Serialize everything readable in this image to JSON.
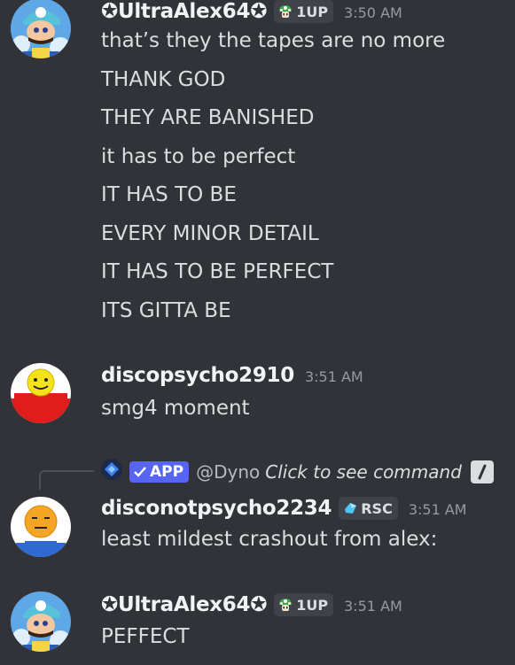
{
  "messages": [
    {
      "username": "✪UltraAlex64✪",
      "tag": "1UP",
      "timestamp": "3:50 AM",
      "lines": [
        "that’s they the tapes are no more",
        "THANK GOD",
        "THEY ARE BANISHED",
        "it has to be perfect",
        "IT HAS TO BE",
        "EVERY MINOR DETAIL",
        "IT HAS TO BE PERFECT",
        "ITS GITTA BE"
      ]
    },
    {
      "username": "discopsycho2910",
      "timestamp": "3:51 AM",
      "lines": [
        "smg4 moment"
      ]
    },
    {
      "reply": {
        "app_label": "APP",
        "user": "@Dyno",
        "command": "Click to see command"
      },
      "username": "disconotpsycho2234",
      "tag": "RSC",
      "timestamp": "3:51 AM",
      "lines": [
        "least mildest crashout from alex:"
      ]
    },
    {
      "username": "✪UltraAlex64✪",
      "tag": "1UP",
      "timestamp": "3:51 AM",
      "lines": [
        "PEFFECT"
      ]
    }
  ],
  "colors": {
    "background": "#313338",
    "text": "#dbdee1",
    "username": "#f2f3f5",
    "timestamp": "#949ba4",
    "app_badge": "#5865f2"
  }
}
